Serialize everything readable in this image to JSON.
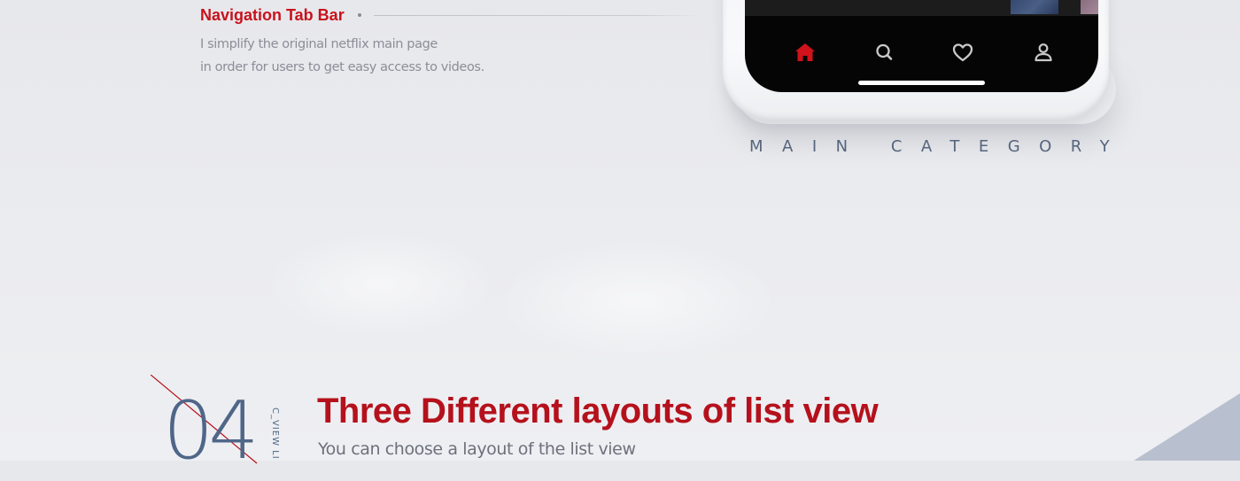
{
  "nav_section": {
    "title": "Navigation Tab Bar",
    "description_line1": "I simplify the original netflix main page",
    "description_line2": "in order for users to get easy access to videos."
  },
  "phone": {
    "tabs": [
      {
        "icon": "home-icon",
        "active": true
      },
      {
        "icon": "search-icon",
        "active": false
      },
      {
        "icon": "heart-icon",
        "active": false
      },
      {
        "icon": "profile-icon",
        "active": false
      }
    ],
    "active_color": "#d0121c",
    "inactive_color": "#c9c9c9"
  },
  "caption": "MAIN CATEGORY",
  "section": {
    "number": "04",
    "vertical_label": "C_VIEW LI",
    "title": "Three Different layouts of list view",
    "subtitle": "You can choose a layout of the list view"
  },
  "colors": {
    "accent_red": "#c8121d",
    "slate_blue": "#4f6688",
    "background": "#e9eaed"
  }
}
